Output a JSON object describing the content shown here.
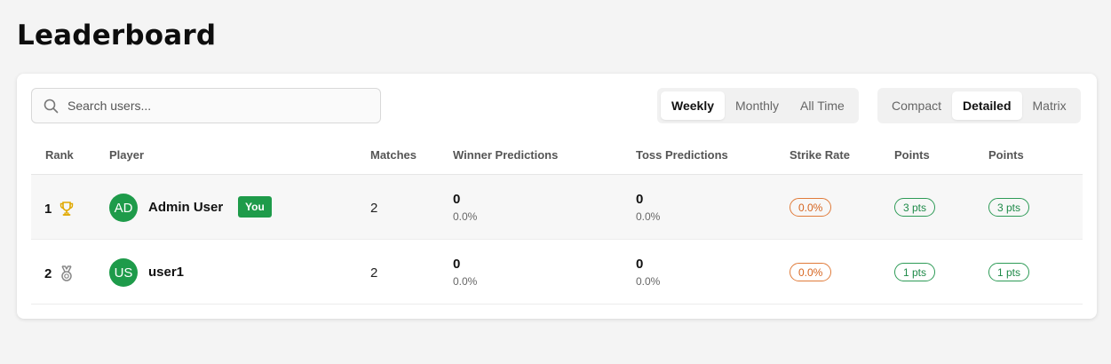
{
  "page": {
    "title": "Leaderboard"
  },
  "search": {
    "placeholder": "Search users..."
  },
  "time_filter": {
    "options": [
      "Weekly",
      "Monthly",
      "All Time"
    ],
    "selected": "Weekly"
  },
  "view_mode": {
    "options": [
      "Compact",
      "Detailed",
      "Matrix"
    ],
    "selected": "Detailed"
  },
  "table": {
    "headers": {
      "rank": "Rank",
      "player": "Player",
      "matches": "Matches",
      "winner": "Winner Predictions",
      "toss": "Toss Predictions",
      "strike_rate": "Strike Rate",
      "points1": "Points",
      "points2": "Points"
    },
    "rows": [
      {
        "rank": "1",
        "rank_icon": "trophy-icon",
        "initials": "AD",
        "name": "Admin User",
        "badge": "You",
        "matches": "2",
        "winner_count": "0",
        "winner_pct": "0.0%",
        "toss_count": "0",
        "toss_pct": "0.0%",
        "strike_rate": "0.0%",
        "points1": "3 pts",
        "points2": "3 pts"
      },
      {
        "rank": "2",
        "rank_icon": "medal-icon",
        "initials": "US",
        "name": "user1",
        "matches": "2",
        "winner_count": "0",
        "winner_pct": "0.0%",
        "toss_count": "0",
        "toss_pct": "0.0%",
        "strike_rate": "0.0%",
        "points1": "1 pts",
        "points2": "1 pts"
      }
    ]
  },
  "colors": {
    "accent_green": "#1e9b4a",
    "strike_orange": "#d6641e",
    "trophy_gold": "#e0a800",
    "medal_gray": "#888888"
  }
}
